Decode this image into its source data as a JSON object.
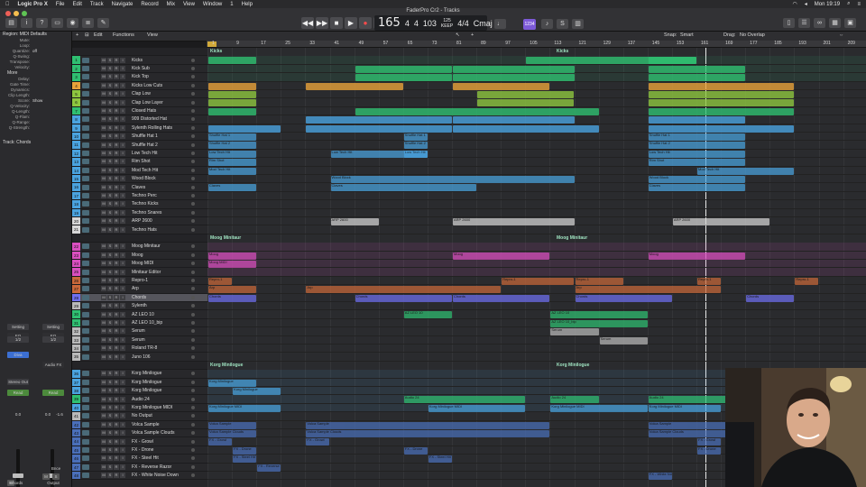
{
  "menubar": {
    "app": "Logic Pro X",
    "items": [
      "File",
      "Edit",
      "Track",
      "Navigate",
      "Record",
      "Mix",
      "View",
      "Window",
      "1",
      "Help"
    ],
    "clock": "Mon 19:19"
  },
  "window": {
    "title": "FaderPro Cr2 - Tracks"
  },
  "transport": {
    "bar": "165",
    "beat": "4",
    "div": "4",
    "tick": "103",
    "tempo": "125",
    "tempo_label": "KEEP",
    "sig": "4/4",
    "key": "Cmaj",
    "count_in": "1234"
  },
  "arrange_header": {
    "edit": "Edit",
    "functions": "Functions",
    "view": "View",
    "snap_label": "Snap:",
    "snap_value": "Smart",
    "drag_label": "Drag:",
    "drag_value": "No Overlap"
  },
  "ruler": [
    "1",
    "9",
    "17",
    "25",
    "33",
    "41",
    "49",
    "57",
    "65",
    "73",
    "81",
    "89",
    "97",
    "105",
    "113",
    "121",
    "129",
    "137",
    "145",
    "153",
    "161",
    "169",
    "177",
    "185",
    "193",
    "201",
    "209"
  ],
  "inspector": {
    "region_label": "Region: MIDI Defaults",
    "params": [
      {
        "k": "Mute:",
        "v": ""
      },
      {
        "k": "Loop:",
        "v": ""
      },
      {
        "k": "Quantize:",
        "v": "off"
      },
      {
        "k": "Q-Swing:",
        "v": ""
      },
      {
        "k": "Transpose:",
        "v": ""
      },
      {
        "k": "Velocity:",
        "v": ""
      }
    ],
    "more_label": "More",
    "more_params": [
      {
        "k": "Delay:",
        "v": ""
      },
      {
        "k": "Gate Time:",
        "v": ""
      },
      {
        "k": "Dynamics:",
        "v": ""
      },
      {
        "k": "Clip Length:",
        "v": ""
      },
      {
        "k": "Score:",
        "v": "Show"
      },
      {
        "k": "Q-Velocity:",
        "v": ""
      },
      {
        "k": "Q-Length:",
        "v": ""
      },
      {
        "k": "Q-Flam:",
        "v": ""
      },
      {
        "k": "Q-Range:",
        "v": ""
      },
      {
        "k": "Q-Strength:",
        "v": ""
      }
    ],
    "track_label": "Track: Chords",
    "strip_a": {
      "setting": "Setting",
      "eq": "EQ",
      "io": "1/2",
      "insert": "Diva",
      "send": "Stereo Out",
      "mode": "Read",
      "val1": "0.0",
      "name": "Chords"
    },
    "strip_b": {
      "setting": "Setting",
      "eq": "EQ",
      "io": "1/2",
      "insert": "Audio FX",
      "mode": "Read",
      "val1": "0.0",
      "val2": "-1.6",
      "bnce": "Bnce",
      "name": "Output"
    }
  },
  "tracks": [
    {
      "n": "1",
      "name": "Kicks",
      "color": "#2fbf71"
    },
    {
      "n": "2",
      "name": "Kick Sub",
      "color": "#2fbf71"
    },
    {
      "n": "3",
      "name": "Kick Top",
      "color": "#2fbf71"
    },
    {
      "n": "4",
      "name": "Kicks Low Cuts",
      "color": "#e8a23a"
    },
    {
      "n": "5",
      "name": "Clap Low",
      "color": "#8dc63f"
    },
    {
      "n": "6",
      "name": "Clap Low Layer",
      "color": "#8dc63f"
    },
    {
      "n": "7",
      "name": "Closed Hats",
      "color": "#2fbf71"
    },
    {
      "n": "8",
      "name": "909 Distorted Hat",
      "color": "#4aa3df"
    },
    {
      "n": "9",
      "name": "Sylenth Rolling Hats",
      "color": "#4aa3df"
    },
    {
      "n": "10",
      "name": "Shuffle Hat 1",
      "color": "#4aa3df"
    },
    {
      "n": "11",
      "name": "Shuffle Hat 2",
      "color": "#4aa3df"
    },
    {
      "n": "12",
      "name": "Low Tech Hit",
      "color": "#4aa3df"
    },
    {
      "n": "13",
      "name": "Rim Shot",
      "color": "#4aa3df"
    },
    {
      "n": "14",
      "name": "Mod Tech Hit",
      "color": "#4aa3df"
    },
    {
      "n": "15",
      "name": "Wood Block",
      "color": "#4aa3df"
    },
    {
      "n": "16",
      "name": "Claves",
      "color": "#4aa3df"
    },
    {
      "n": "17",
      "name": "Techno Perc",
      "color": "#4aa3df"
    },
    {
      "n": "18",
      "name": "Techno Kicks",
      "color": "#4aa3df"
    },
    {
      "n": "19",
      "name": "Techno Snares",
      "color": "#4aa3df"
    },
    {
      "n": "20",
      "name": "ARP 2600",
      "color": "#d6d6d6"
    },
    {
      "n": "21",
      "name": "Techno Hats",
      "color": "#d6d6d6"
    },
    {
      "n": "22",
      "name": "Moog Minitaur",
      "color": "#d94fbf"
    },
    {
      "n": "23",
      "name": "Moog",
      "color": "#d94fbf"
    },
    {
      "n": "24",
      "name": "Moog MIDI",
      "color": "#d94fbf"
    },
    {
      "n": "25",
      "name": "Minitaur Editor",
      "color": "#d94fbf"
    },
    {
      "n": "26",
      "name": "Repro-1",
      "color": "#c9683a"
    },
    {
      "n": "27",
      "name": "Arp",
      "color": "#c9683a"
    },
    {
      "n": "28",
      "name": "Chords",
      "color": "#6f6ff0"
    },
    {
      "n": "29",
      "name": "Sylenth",
      "color": "#b9b9b9"
    },
    {
      "n": "30",
      "name": "AZ LEO 10",
      "color": "#2fbf71"
    },
    {
      "n": "31",
      "name": "AZ LEO 10_bip",
      "color": "#2fbf71"
    },
    {
      "n": "32",
      "name": "Serum",
      "color": "#b9b9b9"
    },
    {
      "n": "33",
      "name": "Serum",
      "color": "#b9b9b9"
    },
    {
      "n": "34",
      "name": "Roland TR-8",
      "color": "#b9b9b9"
    },
    {
      "n": "35",
      "name": "Juno 106",
      "color": "#b9b9b9"
    },
    {
      "n": "36",
      "name": "Korg Minilogue",
      "color": "#4aa3df"
    },
    {
      "n": "37",
      "name": "Korg Minilogue",
      "color": "#4aa3df"
    },
    {
      "n": "38",
      "name": "Korg Minilogue",
      "color": "#4aa3df"
    },
    {
      "n": "39",
      "name": "Audio 24",
      "color": "#2fbf71"
    },
    {
      "n": "40",
      "name": "Korg Minilogue MIDI",
      "color": "#4aa3df"
    },
    {
      "n": "41",
      "name": "No Output",
      "color": "#b9b9b9"
    },
    {
      "n": "42",
      "name": "Volca Sample",
      "color": "#4a6fb9"
    },
    {
      "n": "43",
      "name": "Volca Sample Clouds",
      "color": "#4a6fb9"
    },
    {
      "n": "44",
      "name": "FX - Growl",
      "color": "#4a6fb9"
    },
    {
      "n": "45",
      "name": "FX - Drone",
      "color": "#4a6fb9"
    },
    {
      "n": "46",
      "name": "FX - Steel Hit",
      "color": "#4a6fb9"
    },
    {
      "n": "47",
      "name": "FX - Reverse Razor",
      "color": "#4a6fb9"
    },
    {
      "n": "48",
      "name": "FX - White Noise Down",
      "color": "#4a6fb9"
    }
  ],
  "folders": [
    {
      "label": "Kicks"
    },
    {
      "label": "Kicks"
    },
    {
      "label": "Moog Minitaur"
    },
    {
      "label": "Moog Minitaur"
    },
    {
      "label": "Korg Minilogue"
    },
    {
      "label": "Korg Minilogue"
    }
  ]
}
